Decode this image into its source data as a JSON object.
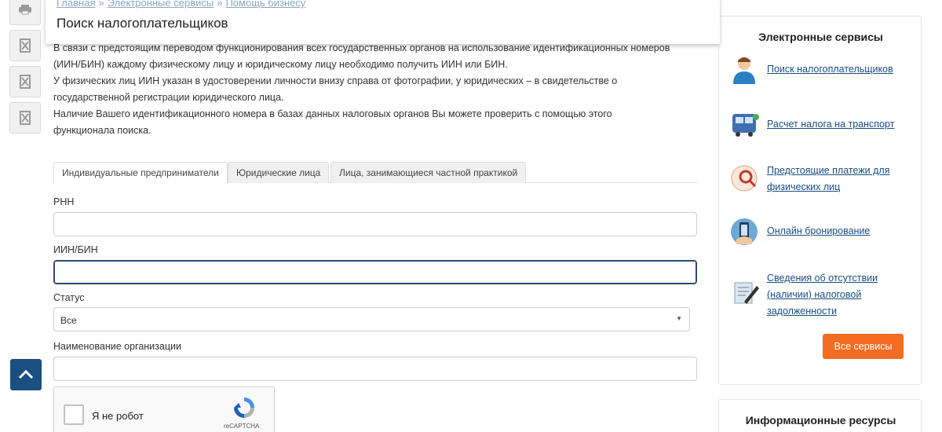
{
  "breadcrumb": [
    "Главная",
    "Электронные сервисы",
    "Помощь бизнесу"
  ],
  "breadcrumb_sep": "»",
  "page_title": "Поиск налогоплательщиков",
  "intro_lines": [
    "В связи с предстоящим переводом функционирования всех государственных органов на использование идентификационных номеров",
    "(ИИН/БИН) каждому физическому лицу и юридическому лицу необходимо получить ИИН или БИН.",
    "У физических лиц ИИН указан в удостоверении личности внизу справа от фотографии, у юридических – в свидетельстве о",
    "государственной регистрации юридического лица.",
    "Наличие Вашего идентификационного номера в базах данных налоговых органов Вы можете проверить с помощью этого",
    "функционала поиска."
  ],
  "tabs": [
    {
      "label": "Индивидуальные предприниматели",
      "active": true
    },
    {
      "label": "Юридические лица",
      "active": false
    },
    {
      "label": "Лица, занимающиеся частной практикой",
      "active": false
    }
  ],
  "form": {
    "rnn_label": "РНН",
    "rnn_value": "",
    "iin_label": "ИИН/БИН",
    "iin_value": "",
    "status_label": "Статус",
    "status_value": "Все",
    "org_label": "Наименование организации",
    "org_value": ""
  },
  "captcha": {
    "label": "Я не робот",
    "brand": "reCAPTCHA"
  },
  "sidebar": {
    "services_title": "Электронные сервисы",
    "services": [
      {
        "lines": [
          "Поиск налогоплательщиков"
        ],
        "icon": "person-icon"
      },
      {
        "lines": [
          "Расчет налога на транспорт"
        ],
        "icon": "bus-icon"
      },
      {
        "lines": [
          "Предстоящие платежи для",
          "физических лиц"
        ],
        "icon": "search-payment-icon"
      },
      {
        "lines": [
          "Онлайн бронирование"
        ],
        "icon": "phone-booking-icon"
      },
      {
        "lines": [
          "Сведения об отсутствии",
          "(наличии) налоговой",
          "задолженности"
        ],
        "icon": "document-pen-icon"
      }
    ],
    "all_services_button": "Все сервисы",
    "info_title": "Информационные ресурсы"
  },
  "colors": {
    "accent": "#f36c21",
    "link": "#1a4d80",
    "top_button": "#1b4f80"
  }
}
